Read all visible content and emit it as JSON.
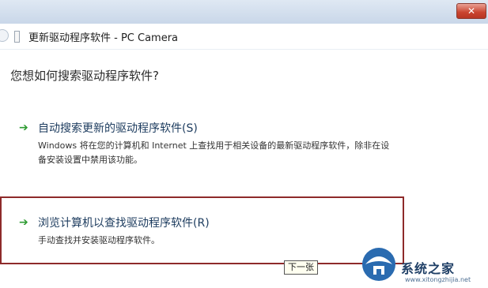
{
  "window": {
    "close_glyph": "✕"
  },
  "header": {
    "title": "更新驱动程序软件 - PC Camera"
  },
  "main": {
    "question": "您想如何搜索驱动程序软件?",
    "options": [
      {
        "title": "自动搜索更新的驱动程序软件(S)",
        "description": "Windows 将在您的计算机和 Internet 上查找用于相关设备的最新驱动程序软件，除非在设备安装设置中禁用该功能。",
        "icon": "green-arrow-icon"
      },
      {
        "title": "浏览计算机以查找驱动程序软件(R)",
        "description": "手动查找并安装驱动程序软件。",
        "icon": "green-arrow-icon"
      }
    ]
  },
  "tooltip": {
    "text": "下一张"
  },
  "watermark": {
    "name": "系统之家",
    "url": "www.xitongzhijia.net"
  },
  "colors": {
    "highlight_frame": "#8e2a2a",
    "arrow": "#2e9b32",
    "option_title": "#1c3b5e"
  }
}
